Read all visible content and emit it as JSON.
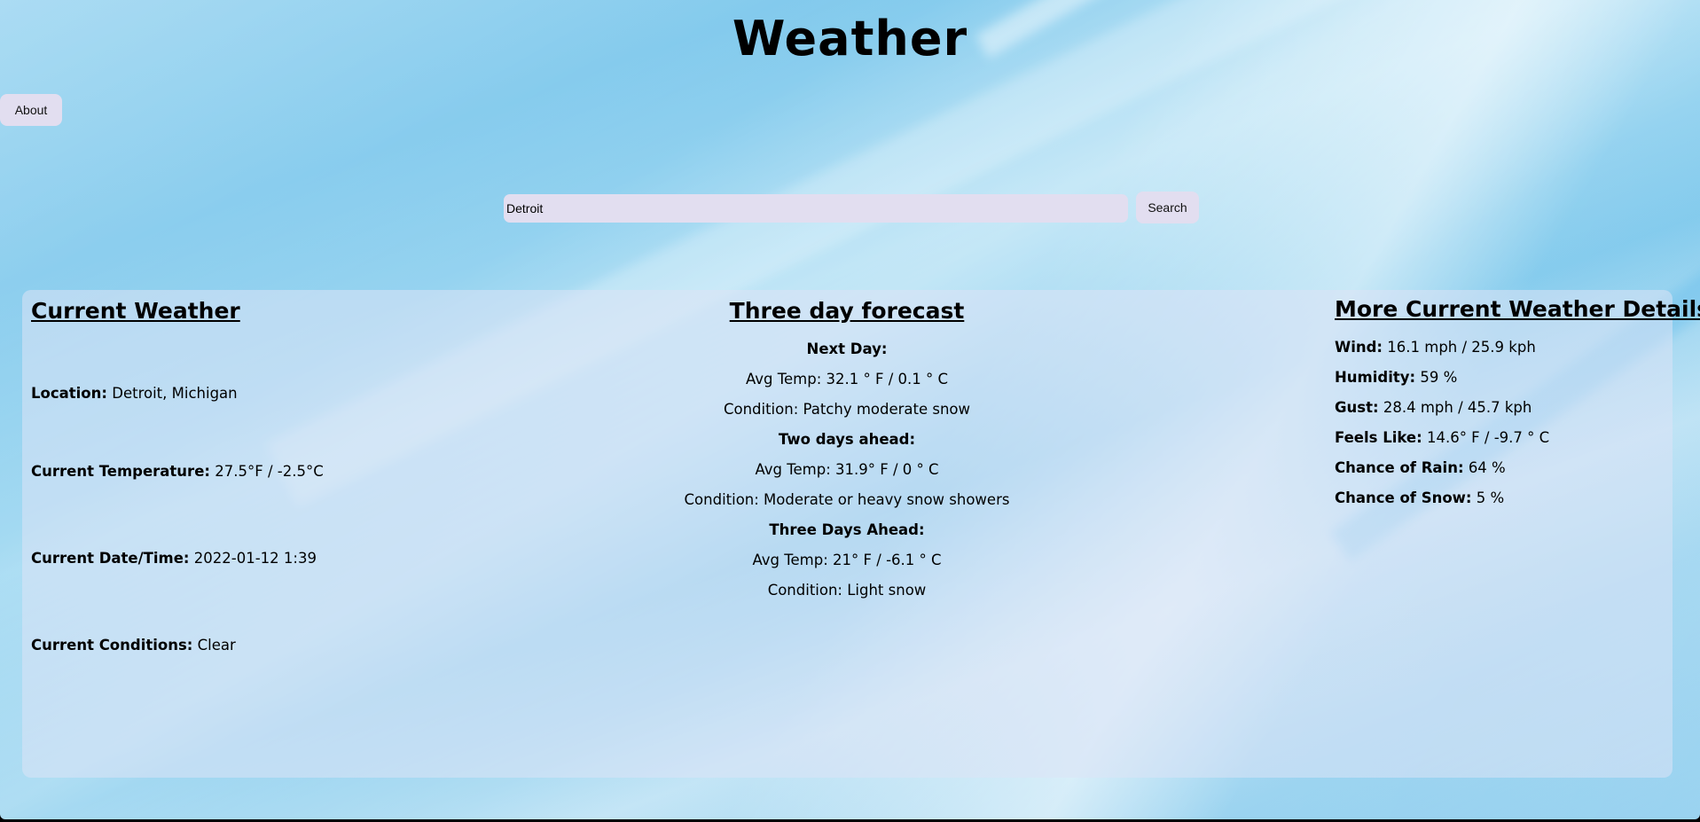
{
  "header": {
    "title": "Weather",
    "about_label": "About"
  },
  "search": {
    "value": "Detroit",
    "button_label": "Search"
  },
  "current": {
    "heading": "Current Weather",
    "location_label": "Location:",
    "location_value": "Detroit, Michigan",
    "temperature_label": "Current Temperature:",
    "temperature_value": "27.5°F / -2.5°C",
    "datetime_label": "Current Date/Time:",
    "datetime_value": "2022-01-12 1:39",
    "conditions_label": "Current Conditions:",
    "conditions_value": "Clear"
  },
  "forecast": {
    "heading": "Three day forecast",
    "days": [
      {
        "label": "Next Day:",
        "avg_temp": "Avg Temp: 32.1 ° F / 0.1 ° C",
        "condition": "Condition: Patchy moderate snow"
      },
      {
        "label": "Two days ahead:",
        "avg_temp": "Avg Temp: 31.9° F / 0 ° C",
        "condition": "Condition: Moderate or heavy snow showers"
      },
      {
        "label": "Three Days Ahead:",
        "avg_temp": "Avg Temp: 21° F / -6.1 ° C",
        "condition": "Condition: Light snow"
      }
    ]
  },
  "details": {
    "heading": "More Current Weather Details",
    "items": [
      {
        "label": "Wind:",
        "value": "16.1 mph / 25.9 kph"
      },
      {
        "label": "Humidity:",
        "value": "59 %"
      },
      {
        "label": "Gust:",
        "value": "28.4 mph / 45.7 kph"
      },
      {
        "label": "Feels Like:",
        "value": "14.6° F / -9.7 ° C"
      },
      {
        "label": "Chance of Rain:",
        "value": "64 %"
      },
      {
        "label": "Chance of Snow:",
        "value": "5 %"
      }
    ]
  }
}
